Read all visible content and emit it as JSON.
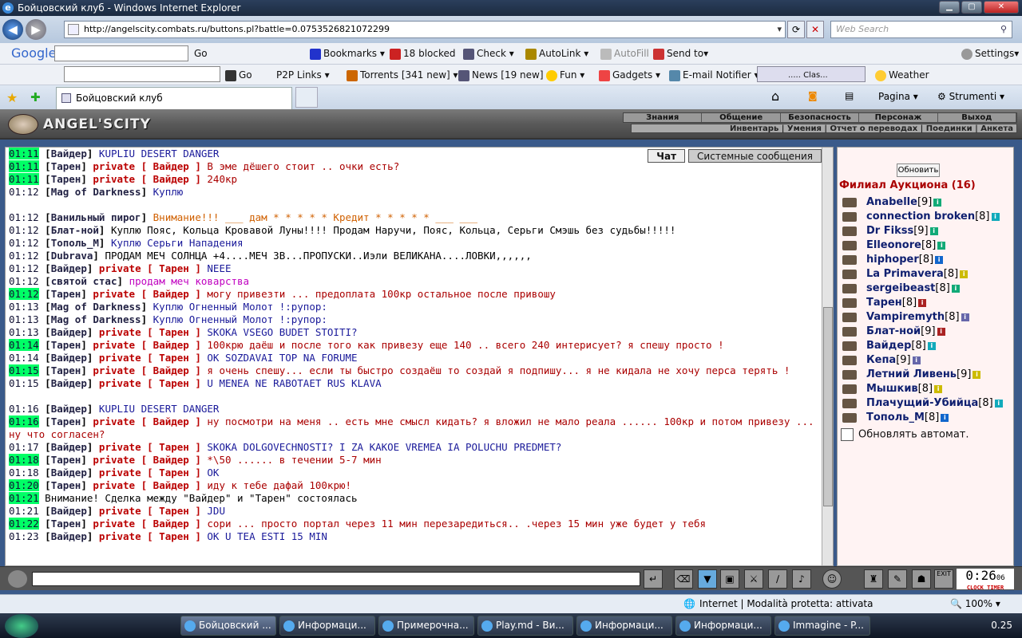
{
  "window": {
    "title": "Бойцовский клуб - Windows Internet Explorer"
  },
  "address": {
    "url": "http://angelscity.combats.ru/buttons.pl?battle=0.0753526821072299",
    "search_placeholder": "Web Search"
  },
  "toolbar1": {
    "google": "Google",
    "go": "Go",
    "bookmarks": "Bookmarks",
    "blocked": "18 blocked",
    "check": "Check",
    "autolink": "AutoLink",
    "autofill": "AutoFill",
    "sendto": "Send to",
    "settings": "Settings"
  },
  "toolbar2": {
    "go": "Go",
    "p2p": "P2P Links",
    "torrents": "Torrents",
    "torrents_count": "[341 new]",
    "news": "News",
    "news_count": "[19 new]",
    "fun": "Fun",
    "gadgets": "Gadgets",
    "email": "E-mail Notifier",
    "clas": "..... Clas...",
    "weather": "Weather"
  },
  "tabs": {
    "active": "Бойцовский клуб",
    "pagina": "Pagina",
    "strumenti": "Strumenti"
  },
  "game": {
    "logo": "ANGEL'SCITY",
    "menu_top": [
      "Знания",
      "Общение",
      "Безопасность",
      "Персонаж",
      "Выход"
    ],
    "menu_bottom": "Инвентарь | Умения | Отчет о переводах | Поединки | Анкета"
  },
  "chat": {
    "tabs": [
      "Чат",
      "Системные сообщения"
    ],
    "lines": [
      {
        "t": "01:11",
        "hl": true,
        "nick": "Вайдер",
        "priv": "",
        "msg": "KUPLIU DESERT DANGER",
        "cls": "msg"
      },
      {
        "t": "01:11",
        "hl": true,
        "nick": "Тарен",
        "priv": "private [ Вайдер ]",
        "msg": "В эме дёшего стоит .. очки есть?",
        "cls": "msgr"
      },
      {
        "t": "01:11",
        "hl": true,
        "nick": "Тарен",
        "priv": "private [ Вайдер ]",
        "msg": "240кр",
        "cls": "msgr"
      },
      {
        "t": "01:12",
        "hl": false,
        "nick": "Mag of Darkness",
        "priv": "",
        "msg": "Куплю",
        "cls": "msg"
      },
      {
        "t": "",
        "hl": false,
        "nick": "",
        "priv": "",
        "msg": "",
        "cls": "msg"
      },
      {
        "t": "01:12",
        "hl": false,
        "nick": "Ванильный пирог",
        "priv": "",
        "msg": "Внимание!!!        ___ дам * * * * * Кредит * * * * * ___      ___",
        "cls": "msgo"
      },
      {
        "t": "01:12",
        "hl": false,
        "nick": "Блат-ной",
        "priv": "",
        "msg": "Куплю Пояс, Кольца Кровавой Луны!!!!      Продам Наручи, Пояс, Кольца, Серьги Смэшь без судьбы!!!!!",
        "cls": "msgc"
      },
      {
        "t": "01:12",
        "hl": false,
        "nick": "Тополь_М",
        "priv": "",
        "msg": "      Куплю Серьги Нападения",
        "cls": "msg"
      },
      {
        "t": "01:12",
        "hl": false,
        "nick": "Dubrava",
        "priv": "",
        "msg": "ПРОДАМ МЕЧ СОЛНЦА +4....МЕЧ ЗВ...ПРОПУСКИ..Иэли ВЕЛИКАНА....ЛОВКИ,,,,,,",
        "cls": "msgc"
      },
      {
        "t": "01:12",
        "hl": false,
        "nick": "Вайдер",
        "priv": "private [ Тарен ]",
        "msg": "NEEE",
        "cls": "msg"
      },
      {
        "t": "01:12",
        "hl": false,
        "nick": "святой стас",
        "priv": "",
        "msg": "продам меч коварства",
        "cls": "msgm"
      },
      {
        "t": "01:12",
        "hl": true,
        "nick": "Тарен",
        "priv": "private [ Вайдер ]",
        "msg": "могу привезти ... предоплата 100кр остальное после привошу",
        "cls": "msgr"
      },
      {
        "t": "01:13",
        "hl": false,
        "nick": "Mag of Darkness",
        "priv": "",
        "msg": "Куплю Огненный Молот !:рупор:",
        "cls": "msg"
      },
      {
        "t": "01:13",
        "hl": false,
        "nick": "Mag of Darkness",
        "priv": "",
        "msg": "Куплю Огненный Молот !:рупор:",
        "cls": "msg"
      },
      {
        "t": "01:13",
        "hl": false,
        "nick": "Вайдер",
        "priv": "private [ Тарен ]",
        "msg": "SKOKA VSEGO BUDET STOITI?",
        "cls": "msg"
      },
      {
        "t": "01:14",
        "hl": true,
        "nick": "Тарен",
        "priv": "private [ Вайдер ]",
        "msg": "100крю даёш и после того как привезу еще 140 .. всего 240 интерисует? я спешу просто !",
        "cls": "msgr"
      },
      {
        "t": "01:14",
        "hl": false,
        "nick": "Вайдер",
        "priv": "private [ Тарен ]",
        "msg": "OK SOZDAVAI TOP NA FORUME",
        "cls": "msg"
      },
      {
        "t": "01:15",
        "hl": true,
        "nick": "Тарен",
        "priv": "private [ Вайдер ]",
        "msg": "я очень спешу... если ты быстро создаёш то создай я подпишу... я не кидала не хочу перса терять !",
        "cls": "msgr"
      },
      {
        "t": "01:15",
        "hl": false,
        "nick": "Вайдер",
        "priv": "private [ Тарен ]",
        "msg": "U MENEA NE RABOTAET RUS KLAVA",
        "cls": "msg"
      },
      {
        "t": "",
        "hl": false,
        "nick": "",
        "priv": "",
        "msg": "",
        "cls": "msg"
      },
      {
        "t": "01:16",
        "hl": false,
        "nick": "Вайдер",
        "priv": "",
        "msg": "      KUPLIU DESERT DANGER",
        "cls": "msg"
      },
      {
        "t": "01:16",
        "hl": true,
        "nick": "Тарен",
        "priv": "private [ Вайдер ]",
        "msg": "ну посмотри на меня .. есть мне смысл кидать? я вложил не мало реала ...... 100кр и потом привезу ... ну что согласен?",
        "cls": "msgr",
        "wrap": true
      },
      {
        "t": "01:17",
        "hl": false,
        "nick": "Вайдер",
        "priv": "private [ Тарен ]",
        "msg": "SKOKA DOLGOVECHNOSTI? I ZA KAKOE VREMEA IA POLUCHU PREDMET?",
        "cls": "msg"
      },
      {
        "t": "01:18",
        "hl": true,
        "nick": "Тарен",
        "priv": "private [ Вайдер ]",
        "msg": "*\\50 ...... в течении 5-7 мин",
        "cls": "msgr"
      },
      {
        "t": "01:18",
        "hl": false,
        "nick": "Вайдер",
        "priv": "private [ Тарен ]",
        "msg": "OK",
        "cls": "msg"
      },
      {
        "t": "01:20",
        "hl": true,
        "nick": "Тарен",
        "priv": "private [ Вайдер ]",
        "msg": "иду к тебе дафай 100крю!",
        "cls": "msgr"
      },
      {
        "t": "01:21",
        "hl": true,
        "nick": "",
        "priv": "",
        "msg": "Внимание! Сделка между \"Вайдер\" и \"Тарен\" состоялась",
        "cls": "msgc",
        "sys": true
      },
      {
        "t": "01:21",
        "hl": false,
        "nick": "Вайдер",
        "priv": "private [ Тарен ]",
        "msg": "JDU",
        "cls": "msg"
      },
      {
        "t": "01:22",
        "hl": true,
        "nick": "Тарен",
        "priv": "private [ Вайдер ]",
        "msg": "сори ... просто портал через 11 мин перезаредиться.. .через 15 мин уже будет у тебя",
        "cls": "msgr"
      },
      {
        "t": "01:23",
        "hl": false,
        "nick": "Вайдер",
        "priv": "private [ Тарен ]",
        "msg": "OK U TEA ESTI 15 MIN",
        "cls": "msg"
      }
    ]
  },
  "room": {
    "refresh": "Обновить",
    "title": "Филиал Аукциона (16)",
    "players": [
      {
        "name": "Anabelle",
        "level": "[9]",
        "info": "#1a7"
      },
      {
        "name": "connection broken",
        "level": "[8]",
        "info": "#1ab"
      },
      {
        "name": "Dr Fikss",
        "level": "[9]",
        "info": "#1a7"
      },
      {
        "name": "Elleonore",
        "level": "[8]",
        "info": "#1a7"
      },
      {
        "name": "hiphoper",
        "level": "[8]",
        "info": "#16c"
      },
      {
        "name": "La Primavera",
        "level": "[8]",
        "info": "#cb0"
      },
      {
        "name": "sergeibeast",
        "level": "[8]",
        "info": "#1a7"
      },
      {
        "name": "Тарен",
        "level": "[8]",
        "info": "#a22"
      },
      {
        "name": "Vampiremyth",
        "level": "[8]",
        "info": "#66a"
      },
      {
        "name": "Блат-ной",
        "level": "[9]",
        "info": "#a22"
      },
      {
        "name": "Вайдер",
        "level": "[8]",
        "info": "#1ab"
      },
      {
        "name": "Кепа",
        "level": "[9]",
        "info": "#66a"
      },
      {
        "name": "Летний Ливень",
        "level": "[9]",
        "info": "#cb0"
      },
      {
        "name": "Мышкив",
        "level": "[8]",
        "info": "#cb0"
      },
      {
        "name": "Плачущий-Убийца",
        "level": "[8]",
        "info": "#1ab"
      },
      {
        "name": "Тополь_М",
        "level": "[8]",
        "info": "#16c"
      }
    ],
    "auto_update": "Обновлять автомат."
  },
  "clock": {
    "time": "0:26",
    "sec": "06",
    "labels": "CLOCK TIMER",
    "exit": "EXIT"
  },
  "status": {
    "zone": "Internet | Modalità protetta: attivata",
    "zoom": "100%"
  },
  "taskbar": {
    "items": [
      "Бойцовский ...",
      "Информаци...",
      "Примерочна...",
      "Play.md - Ви...",
      "Информаци...",
      "Информаци...",
      "Immagine - P..."
    ],
    "time": "0.25"
  }
}
